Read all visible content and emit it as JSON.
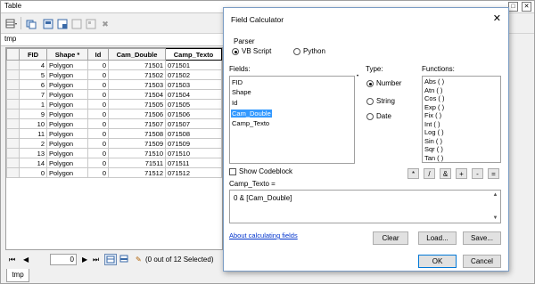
{
  "table_window": {
    "title": "Table",
    "controls": [
      "□",
      "✕"
    ],
    "layer_tab": "tmp",
    "bottom_tab": "tmp",
    "columns": [
      "FID",
      "Shape *",
      "Id",
      "Cam_Double",
      "Camp_Texto"
    ],
    "rows": [
      [
        "4",
        "Polygon",
        "0",
        "71501",
        "071501"
      ],
      [
        "5",
        "Polygon",
        "0",
        "71502",
        "071502"
      ],
      [
        "6",
        "Polygon",
        "0",
        "71503",
        "071503"
      ],
      [
        "7",
        "Polygon",
        "0",
        "71504",
        "071504"
      ],
      [
        "1",
        "Polygon",
        "0",
        "71505",
        "071505"
      ],
      [
        "9",
        "Polygon",
        "0",
        "71506",
        "071506"
      ],
      [
        "10",
        "Polygon",
        "0",
        "71507",
        "071507"
      ],
      [
        "11",
        "Polygon",
        "0",
        "71508",
        "071508"
      ],
      [
        "2",
        "Polygon",
        "0",
        "71509",
        "071509"
      ],
      [
        "13",
        "Polygon",
        "0",
        "71510",
        "071510"
      ],
      [
        "14",
        "Polygon",
        "0",
        "71511",
        "071511"
      ],
      [
        "0",
        "Polygon",
        "0",
        "71512",
        "071512"
      ]
    ],
    "nav": {
      "record_value": "0",
      "selection_status": "(0 out of 12 Selected)"
    }
  },
  "dialog": {
    "title": "Field Calculator",
    "close": "✕",
    "parser_label": "Parser",
    "parser_options": [
      "VB Script",
      "Python"
    ],
    "fields_label": "Fields:",
    "fields": [
      "FID",
      "Shape",
      "Id",
      "Cam_Double",
      "Camp_Texto"
    ],
    "selected_field": "Cam_Double",
    "type_label": "Type:",
    "type_options": [
      "Number",
      "String",
      "Date"
    ],
    "functions_label": "Functions:",
    "functions": [
      "Abs ( )",
      "Atn ( )",
      "Cos ( )",
      "Exp ( )",
      "Fix ( )",
      "Int ( )",
      "Log ( )",
      "Sin ( )",
      "Sqr ( )",
      "Tan ( )"
    ],
    "show_codeblock_label": "Show Codeblock",
    "operators": [
      "*",
      "/",
      "&",
      "+",
      "-",
      "="
    ],
    "expression_label": "Camp_Texto =",
    "expression_value": "0 & [Cam_Double]",
    "help_link": "About calculating fields",
    "buttons": {
      "clear": "Clear",
      "load": "Load...",
      "save": "Save...",
      "ok": "OK",
      "cancel": "Cancel"
    }
  }
}
